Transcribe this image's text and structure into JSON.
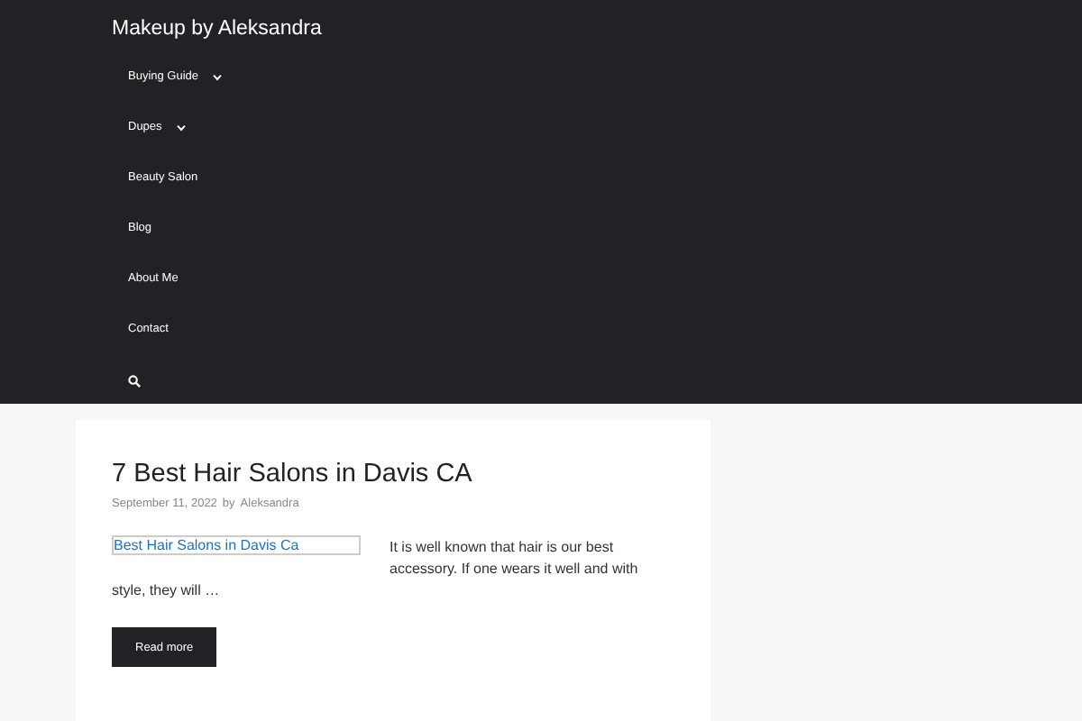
{
  "site_title": "Makeup by Aleksandra",
  "nav": [
    {
      "label": "Buying Guide",
      "has_submenu": true
    },
    {
      "label": "Dupes",
      "has_submenu": true
    },
    {
      "label": "Beauty Salon",
      "has_submenu": false
    },
    {
      "label": "Blog",
      "has_submenu": false
    },
    {
      "label": "About Me",
      "has_submenu": false
    },
    {
      "label": "Contact",
      "has_submenu": false
    }
  ],
  "post": {
    "title": "7 Best Hair Salons in Davis CA",
    "date": "September 11, 2022",
    "by": "by",
    "author": "Aleksandra",
    "image_alt": "Best Hair Salons in Davis Ca",
    "excerpt_beside": "It is well known that hair is our best accessory. If one wears it well and with",
    "excerpt_below": "style, they will …",
    "button": "Read more"
  }
}
